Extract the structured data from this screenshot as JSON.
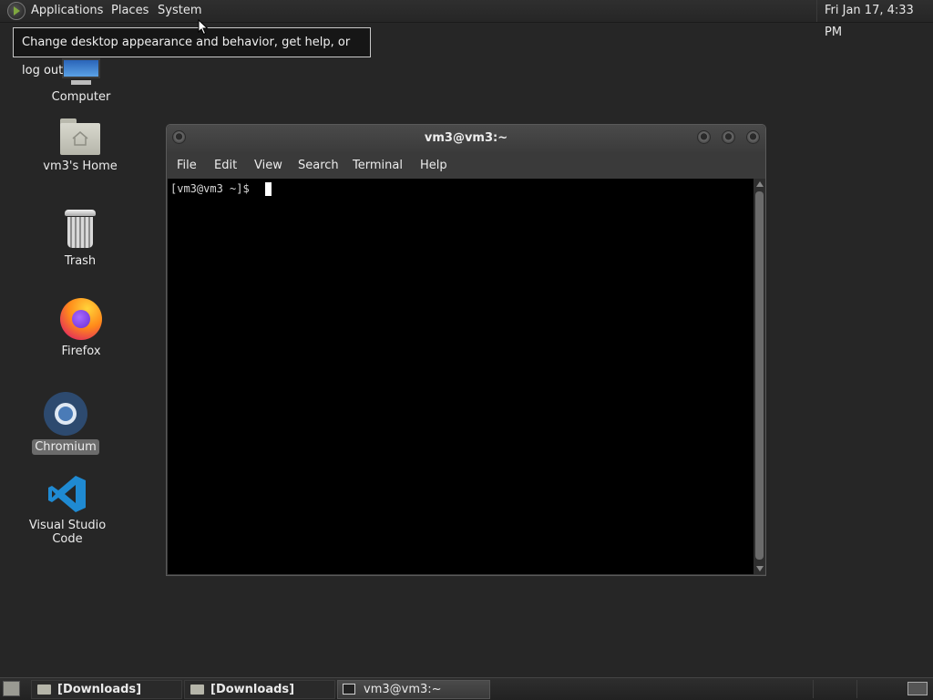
{
  "top_panel": {
    "menus": [
      "Applications",
      "Places",
      "System"
    ],
    "clock": "Fri Jan 17,  4:33 PM"
  },
  "tooltip": "Change desktop appearance and behavior, get help, or log out",
  "desktop_icons": {
    "computer": "Computer",
    "home": "vm3's Home",
    "trash": "Trash",
    "firefox": "Firefox",
    "chromium": "Chromium",
    "vscode": "Visual Studio Code"
  },
  "terminal": {
    "title": "vm3@vm3:~",
    "menus": [
      "File",
      "Edit",
      "View",
      "Search",
      "Terminal",
      "Help"
    ],
    "prompt": "[vm3@vm3 ~]$ "
  },
  "taskbar": {
    "items": [
      "[Downloads]",
      "[Downloads]",
      "vm3@vm3:~"
    ]
  }
}
